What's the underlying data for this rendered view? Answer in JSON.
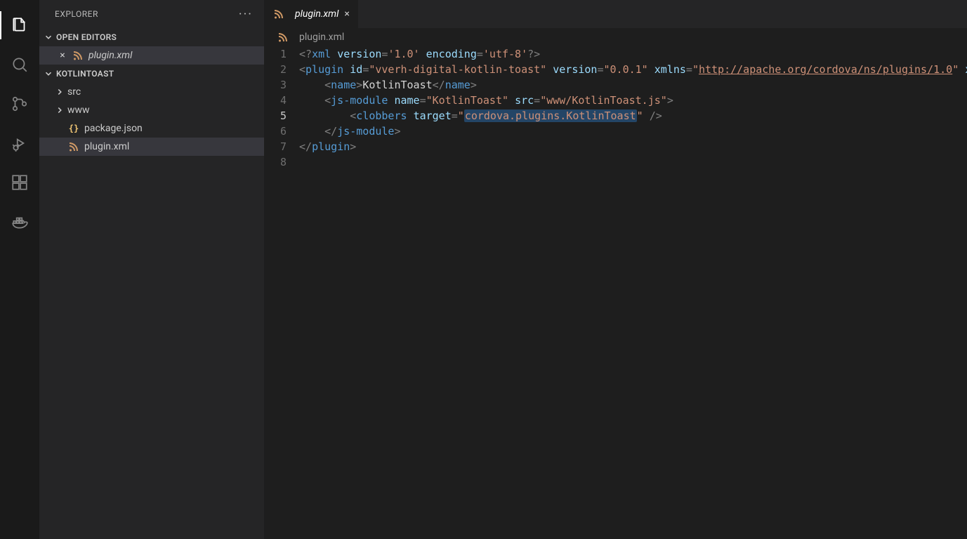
{
  "explorer": {
    "title": "EXPLORER",
    "openEditors": {
      "header": "OPEN EDITORS",
      "items": [
        {
          "name": "plugin.xml",
          "icon": "xml",
          "italic": true,
          "active": true
        }
      ]
    },
    "workspace": {
      "name": "KOTLINTOAST",
      "tree": [
        {
          "type": "folder",
          "name": "src",
          "expanded": false
        },
        {
          "type": "folder",
          "name": "www",
          "expanded": false
        },
        {
          "type": "file",
          "name": "package.json",
          "icon": "json"
        },
        {
          "type": "file",
          "name": "plugin.xml",
          "icon": "xml",
          "selected": true
        }
      ]
    }
  },
  "editor": {
    "tab": {
      "name": "plugin.xml",
      "italic": true,
      "icon": "xml"
    },
    "breadcrumb": {
      "file": "plugin.xml",
      "icon": "xml"
    },
    "currentLine": 5,
    "selection": "cordova.plugins.KotlinToast",
    "lines": [
      {
        "tokens": [
          {
            "t": "<?",
            "c": "punc"
          },
          {
            "t": "xml ",
            "c": "tag"
          },
          {
            "t": "version",
            "c": "attr"
          },
          {
            "t": "=",
            "c": "punc"
          },
          {
            "t": "'1.0'",
            "c": "str"
          },
          {
            "t": " ",
            "c": "text"
          },
          {
            "t": "encoding",
            "c": "attr"
          },
          {
            "t": "=",
            "c": "punc"
          },
          {
            "t": "'utf-8'",
            "c": "str"
          },
          {
            "t": "?>",
            "c": "punc"
          }
        ],
        "indent": 0
      },
      {
        "tokens": [
          {
            "t": "<",
            "c": "punc"
          },
          {
            "t": "plugin ",
            "c": "tag"
          },
          {
            "t": "id",
            "c": "attr"
          },
          {
            "t": "=",
            "c": "punc"
          },
          {
            "t": "\"vverh-digital-kotlin-toast\"",
            "c": "str"
          },
          {
            "t": " ",
            "c": "text"
          },
          {
            "t": "version",
            "c": "attr"
          },
          {
            "t": "=",
            "c": "punc"
          },
          {
            "t": "\"0.0.1\"",
            "c": "str"
          },
          {
            "t": " ",
            "c": "text"
          },
          {
            "t": "xmlns",
            "c": "attr"
          },
          {
            "t": "=",
            "c": "punc"
          },
          {
            "t": "\"",
            "c": "str"
          },
          {
            "t": "http://apache.org/cordova/ns/plugins/1.0",
            "c": "link"
          },
          {
            "t": "\"",
            "c": "str"
          },
          {
            "t": " ",
            "c": "text"
          },
          {
            "t": "xm",
            "c": "attr"
          }
        ],
        "indent": 0
      },
      {
        "tokens": [
          {
            "t": "<",
            "c": "punc"
          },
          {
            "t": "name",
            "c": "tag"
          },
          {
            "t": ">",
            "c": "punc"
          },
          {
            "t": "KotlinToast",
            "c": "text"
          },
          {
            "t": "</",
            "c": "punc"
          },
          {
            "t": "name",
            "c": "tag"
          },
          {
            "t": ">",
            "c": "punc"
          }
        ],
        "indent": 1
      },
      {
        "tokens": [
          {
            "t": "<",
            "c": "punc"
          },
          {
            "t": "js-module ",
            "c": "tag"
          },
          {
            "t": "name",
            "c": "attr"
          },
          {
            "t": "=",
            "c": "punc"
          },
          {
            "t": "\"KotlinToast\"",
            "c": "str"
          },
          {
            "t": " ",
            "c": "text"
          },
          {
            "t": "src",
            "c": "attr"
          },
          {
            "t": "=",
            "c": "punc"
          },
          {
            "t": "\"www/KotlinToast.js\"",
            "c": "str"
          },
          {
            "t": ">",
            "c": "punc"
          }
        ],
        "indent": 1
      },
      {
        "tokens": [
          {
            "t": "<",
            "c": "punc"
          },
          {
            "t": "clobbers ",
            "c": "tag"
          },
          {
            "t": "target",
            "c": "attr"
          },
          {
            "t": "=",
            "c": "punc"
          },
          {
            "t": "\"",
            "c": "str"
          },
          {
            "t": "cordova.plugins.KotlinToast",
            "c": "str",
            "sel": true
          },
          {
            "t": "\"",
            "c": "str"
          },
          {
            "t": " />",
            "c": "punc"
          }
        ],
        "indent": 2
      },
      {
        "tokens": [
          {
            "t": "</",
            "c": "punc"
          },
          {
            "t": "js-module",
            "c": "tag"
          },
          {
            "t": ">",
            "c": "punc"
          }
        ],
        "indent": 1
      },
      {
        "tokens": [
          {
            "t": "</",
            "c": "punc"
          },
          {
            "t": "plugin",
            "c": "tag"
          },
          {
            "t": ">",
            "c": "punc"
          }
        ],
        "indent": 0
      },
      {
        "tokens": [],
        "indent": 0
      }
    ]
  },
  "indentUnit": "    "
}
